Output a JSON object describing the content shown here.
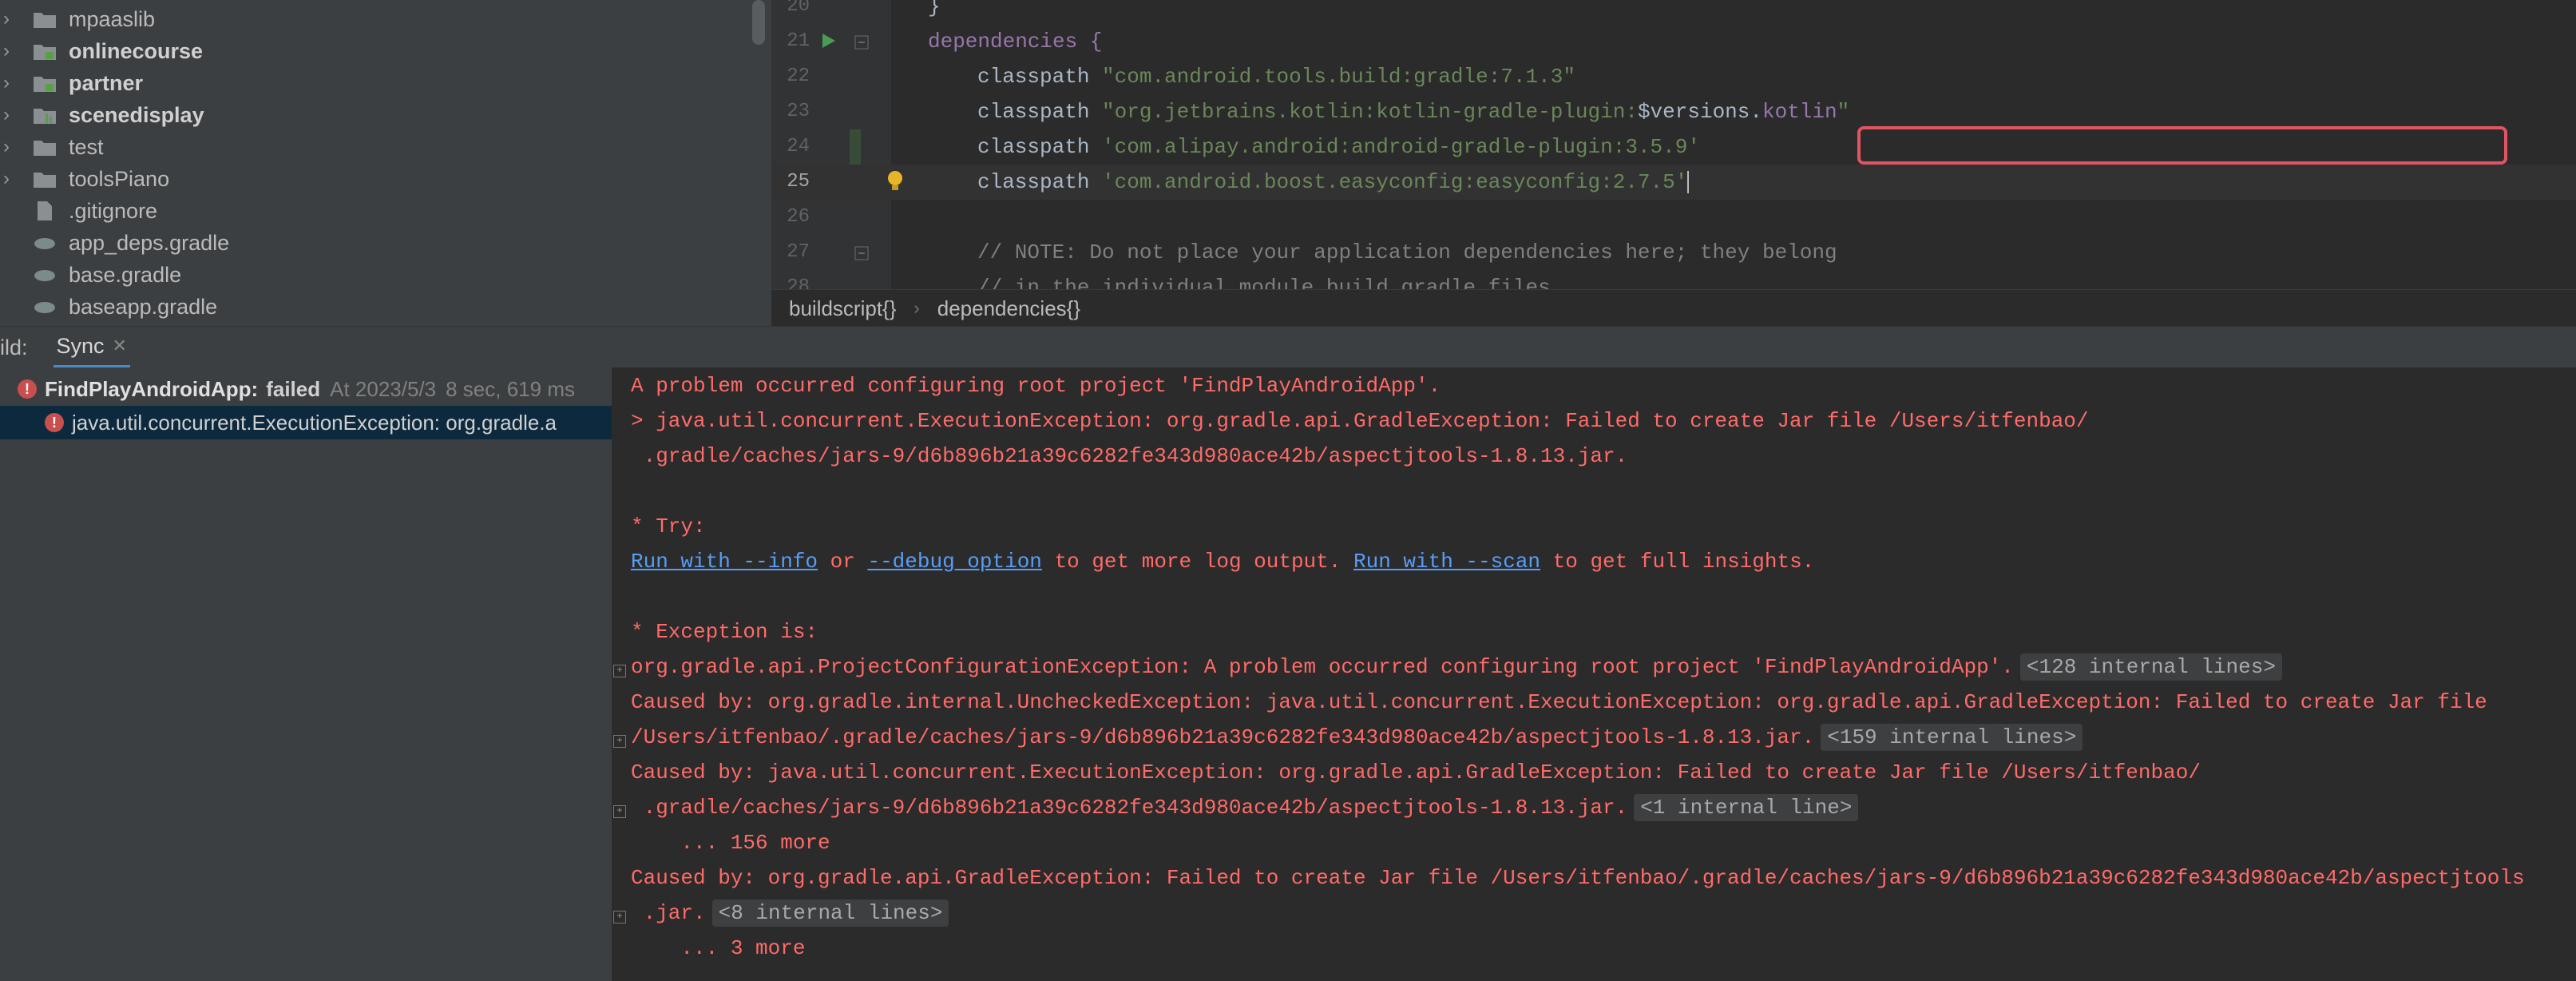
{
  "project_tree": {
    "items": [
      {
        "label": "mpaaslib",
        "kind": "folder",
        "bold": false
      },
      {
        "label": "onlinecourse",
        "kind": "module",
        "bold": true
      },
      {
        "label": "partner",
        "kind": "module",
        "bold": true
      },
      {
        "label": "scenedisplay",
        "kind": "module",
        "bold": true
      },
      {
        "label": "test",
        "kind": "folder",
        "bold": false
      },
      {
        "label": "toolsPiano",
        "kind": "folder",
        "bold": false
      },
      {
        "label": ".gitignore",
        "kind": "file",
        "bold": false
      },
      {
        "label": "app_deps.gradle",
        "kind": "gradle",
        "bold": false
      },
      {
        "label": "base.gradle",
        "kind": "gradle",
        "bold": false
      },
      {
        "label": "baseapp.gradle",
        "kind": "gradle",
        "bold": false
      }
    ]
  },
  "editor": {
    "lines": [
      {
        "num": "20",
        "text": "}"
      },
      {
        "num": "21",
        "text": "dependencies {"
      },
      {
        "num": "22",
        "prefix": "classpath ",
        "str": "\"com.android.tools.build:gradle:7.1.3\""
      },
      {
        "num": "23",
        "prefix": "classpath ",
        "str": "\"org.jetbrains.kotlin:kotlin-gradle-plugin:",
        "var": "$versions.",
        "var2": "kotlin",
        "str_end": "\""
      },
      {
        "num": "24",
        "prefix": "classpath ",
        "str": "'com.alipay.android:android-gradle-plugin:3.5.9'"
      },
      {
        "num": "25",
        "prefix": "classpath ",
        "str": "'com.android.boost.easyconfig:easyconfig:2.7.5'"
      },
      {
        "num": "26",
        "text": ""
      },
      {
        "num": "27",
        "comment": "// NOTE: Do not place your application dependencies here; they belong"
      },
      {
        "num": "28",
        "comment": "// in the individual module build.gradle files"
      }
    ],
    "breadcrumb": [
      "buildscript{}",
      "dependencies{}"
    ],
    "colors": {
      "highlight_box": "#e05561",
      "keyword": "#9876aa",
      "string": "#6a8759"
    }
  },
  "build": {
    "label": "ild:",
    "tab": "Sync",
    "tree": {
      "root_name": "FindPlayAndroidApp:",
      "root_status": "failed",
      "root_time": "At 2023/5/3",
      "root_duration": "8 sec, 619 ms",
      "child": "java.util.concurrent.ExecutionException: org.gradle.a"
    },
    "console": [
      "A problem occurred configuring root project 'FindPlayAndroidApp'.",
      "> java.util.concurrent.ExecutionException: org.gradle.api.GradleException: Failed to create Jar file /Users/itfenbao/",
      " .gradle/caches/jars-9/d6b896b21a39c6282fe343d980ace42b/aspectjtools-1.8.13.jar.",
      "",
      "* Try:",
      "",
      "",
      "* Exception is:",
      "org.gradle.api.ProjectConfigurationException: A problem occurred configuring root project 'FindPlayAndroidApp'.",
      "Caused by: org.gradle.internal.UncheckedException: java.util.concurrent.ExecutionException: org.gradle.api.GradleException: Failed to create Jar file ",
      "/Users/itfenbao/.gradle/caches/jars-9/d6b896b21a39c6282fe343d980ace42b/aspectjtools-1.8.13.jar.",
      "Caused by: java.util.concurrent.ExecutionException: org.gradle.api.GradleException: Failed to create Jar file /Users/itfenbao/",
      " .gradle/caches/jars-9/d6b896b21a39c6282fe343d980ace42b/aspectjtools-1.8.13.jar.",
      "    ... 156 more",
      "Caused by: org.gradle.api.GradleException: Failed to create Jar file /Users/itfenbao/.gradle/caches/jars-9/d6b896b21a39c6282fe343d980ace42b/aspectjtools",
      " .jar.",
      "    ... 3 more"
    ],
    "try_line": {
      "link1": "Run with --info",
      "mid1": " or ",
      "link2": "--debug option",
      "mid2": " to get more log output. ",
      "link3": "Run with --scan",
      "end": " to get full insights."
    },
    "badges": {
      "b128": "<128 internal lines>",
      "b159": "<159 internal lines>",
      "b1": "<1 internal line>",
      "b8": "<8 internal lines>"
    }
  }
}
